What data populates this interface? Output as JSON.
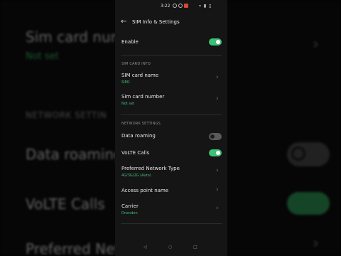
{
  "status_bar": {
    "time": "3:22",
    "system_icons": "▿ ▮ ▯"
  },
  "header": {
    "back_icon": "arrow-left-icon",
    "title": "SIM Info & Settings"
  },
  "enable": {
    "label": "Enable",
    "on": true
  },
  "sim_card_info": {
    "section_title": "SIM CARD INFO",
    "name_label": "SIM card name",
    "name_value": "SIM1",
    "number_label": "Sim card number",
    "number_value": "Not set"
  },
  "network_settings": {
    "section_title": "NETWORK SETTINGS",
    "data_roaming_label": "Data roaming",
    "data_roaming_on": false,
    "volte_label": "VoLTE Calls",
    "volte_on": true,
    "preferred_network_label": "Preferred Network Type",
    "preferred_network_value": "4G/3G/2G (Auto)",
    "apn_label": "Access point name",
    "carrier_label": "Carrier",
    "carrier_value": "Dnenden"
  },
  "navbar": {
    "back_icon": "back-triangle-icon",
    "home_icon": "home-circle-icon",
    "recents_icon": "recents-square-icon"
  },
  "background": {
    "sim_card_number": "Sim card num",
    "not_set": "Not set",
    "network_settings": "NETWORK SETTIN",
    "data_roaming": "Data roaming",
    "volte_calls": "VoLTE Calls",
    "preferred_network": "Preferred Net"
  },
  "colors": {
    "accent": "#39c176",
    "panel": "#151515",
    "toggle_off": "#5a5a5a"
  }
}
